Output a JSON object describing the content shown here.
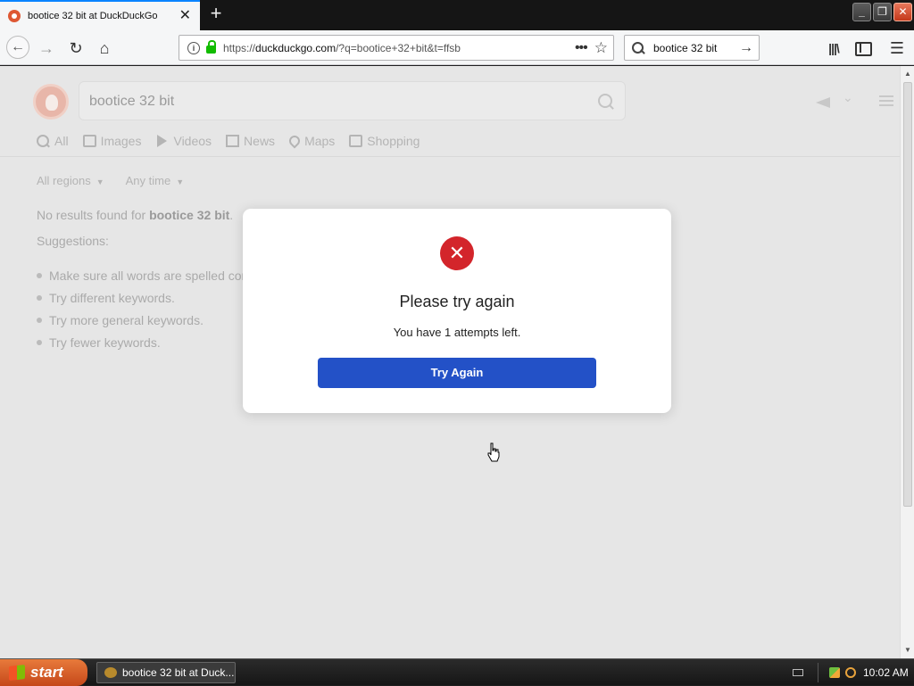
{
  "browser": {
    "tab_title": "bootice 32 bit at DuckDuckGo",
    "url_prefix": "https://",
    "url_host": "duckduckgo.com",
    "url_rest": "/?q=bootice+32+bit&t=ffsb",
    "search_value": "bootice 32 bit"
  },
  "page": {
    "search_value": "bootice 32 bit",
    "tabs": [
      "All",
      "Images",
      "Videos",
      "News",
      "Maps",
      "Shopping"
    ],
    "filters": [
      "All regions",
      "Any time"
    ],
    "noresults_prefix": "No results found for ",
    "noresults_query": "bootice 32 bit",
    "noresults_suffix": ".",
    "suggestions_title": "Suggestions:",
    "suggestions": [
      "Make sure all words are spelled correctly.",
      "Try different keywords.",
      "Try more general keywords.",
      "Try fewer keywords."
    ]
  },
  "modal": {
    "icon": "close-icon",
    "title": "Please try again",
    "message": "You have 1 attempts left.",
    "button": "Try Again",
    "error_color": "#d3252b",
    "button_color": "#2351c7"
  },
  "taskbar": {
    "start_label": "start",
    "task_label": "bootice 32 bit at Duck...",
    "clock": "10:02 AM"
  }
}
